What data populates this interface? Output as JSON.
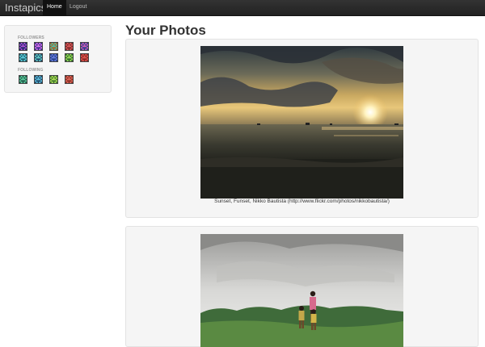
{
  "navbar": {
    "brand": "Instapics",
    "items": [
      {
        "label": "Home",
        "active": true
      },
      {
        "label": "Logout",
        "active": false
      }
    ]
  },
  "sidebar": {
    "followers_label": "FOLLOWERS",
    "following_label": "FOLLOWING",
    "followers": [
      {
        "fg": "#b44fd6",
        "bg": "#1d2a6b"
      },
      {
        "fg": "#e072f0",
        "bg": "#3b2f8c"
      },
      {
        "fg": "#4fc1a8",
        "bg": "#a8642b"
      },
      {
        "fg": "#e05a5a",
        "bg": "#7a2b2b"
      },
      {
        "fg": "#d65fb3",
        "bg": "#2a3f8f"
      },
      {
        "fg": "#5fd1e0",
        "bg": "#1f5f6a"
      },
      {
        "fg": "#64d1c8",
        "bg": "#1f4a6a"
      },
      {
        "fg": "#6a7fe0",
        "bg": "#25408c"
      },
      {
        "fg": "#9fe05a",
        "bg": "#2f6b2b"
      },
      {
        "fg": "#e05a4f",
        "bg": "#8c2525"
      }
    ],
    "following": [
      {
        "fg": "#5fd1a0",
        "bg": "#1f5a4a"
      },
      {
        "fg": "#5fc1e0",
        "bg": "#1f4a6a"
      },
      {
        "fg": "#b4e05a",
        "bg": "#3f7a2b"
      },
      {
        "fg": "#e06a5a",
        "bg": "#8c2f25"
      }
    ]
  },
  "main": {
    "title": "Your Photos",
    "photos": [
      {
        "caption": "Sunset, Funset, Nikko Bautista (http://www.flickr.com/photos/nikkobautista/)"
      },
      {
        "caption": ""
      }
    ]
  }
}
